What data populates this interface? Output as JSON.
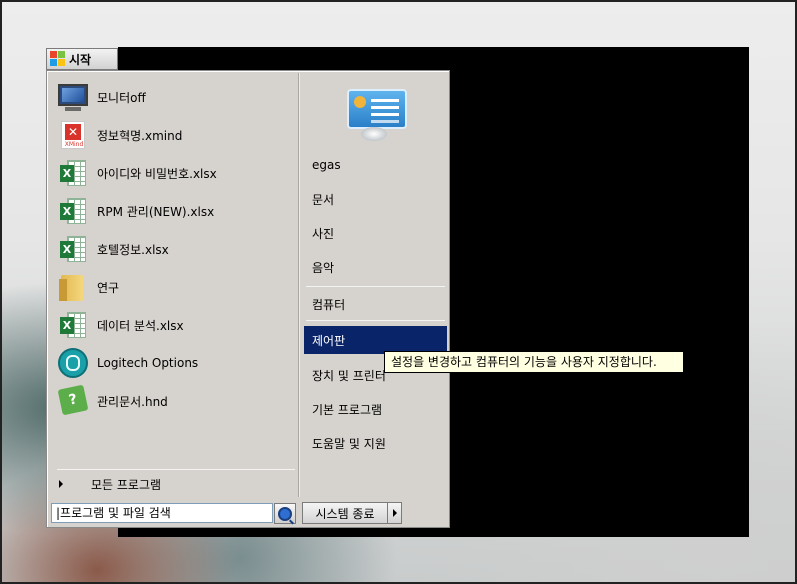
{
  "start_button": {
    "label": "시작",
    "icon": "windows-logo-icon"
  },
  "programs": [
    {
      "label": "모니터off",
      "icon": "monitor-icon"
    },
    {
      "label": "정보혁명.xmind",
      "icon": "xmind-file-icon"
    },
    {
      "label": "아이디와 비밀번호.xlsx",
      "icon": "excel-file-icon"
    },
    {
      "label": "RPM 관리(NEW).xlsx",
      "icon": "excel-file-icon"
    },
    {
      "label": "호텔정보.xlsx",
      "icon": "excel-file-icon"
    },
    {
      "label": "연구",
      "icon": "folder-icon"
    },
    {
      "label": "데이터 분석.xlsx",
      "icon": "excel-file-icon"
    },
    {
      "label": "Logitech Options",
      "icon": "logitech-icon"
    },
    {
      "label": "관리문서.hnd",
      "icon": "hnd-file-icon"
    }
  ],
  "all_programs": {
    "label": "모든 프로그램",
    "icon": "triangle-right-icon"
  },
  "right_pane": {
    "user_picture_icon": "control-panel-picture-icon",
    "items_top": [
      "egas",
      "문서",
      "사진",
      "음악"
    ],
    "items_bottom": [
      "컴퓨터",
      "제어판",
      "장치 및 프린터",
      "기본 프로그램",
      "도움말 및 지원"
    ],
    "highlighted": "제어판"
  },
  "search": {
    "value": "|프로그램 및 파일 검색",
    "button_icon": "search-icon"
  },
  "shutdown": {
    "label": "시스템 종료",
    "arrow_icon": "triangle-right-icon"
  },
  "tooltip": {
    "text": "설정을 변경하고 컴퓨터의 기능을 사용자 지정합니다."
  },
  "colors": {
    "menu_bg": "#d6d3ce",
    "highlight": "#0a246a",
    "tooltip_bg": "#ffffe1"
  }
}
